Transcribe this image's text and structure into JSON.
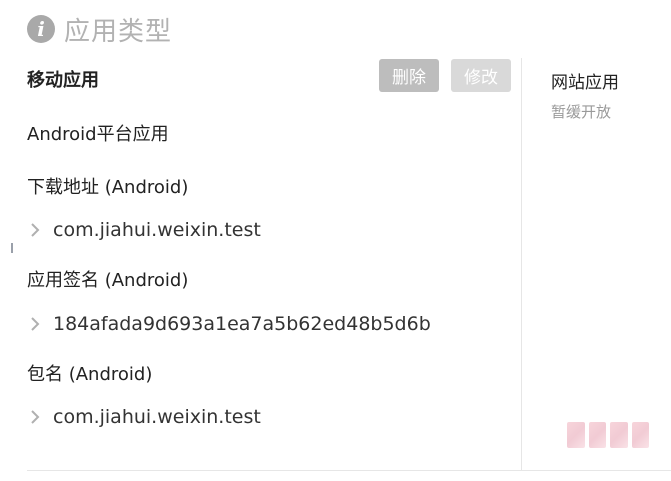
{
  "section": {
    "icon": "info-icon",
    "icon_glyph": "i",
    "title": "应用类型"
  },
  "mobile_app": {
    "title": "移动应用",
    "delete_label": "删除",
    "edit_label": "修改",
    "platform_label": "Android平台应用",
    "download_url_label": "下载地址 (Android)",
    "download_url_value": "com.jiahui.weixin.test",
    "signature_label": "应用签名 (Android)",
    "signature_value": "184afada9d693a1ea7a5b62ed48b5d6b",
    "package_label": "包名 (Android)",
    "package_value": "com.jiahui.weixin.test"
  },
  "website_app": {
    "title": "网站应用",
    "status": "暂缓开放"
  },
  "colors": {
    "icon_bg": "#a9a9a9",
    "title_gray": "#b2b2b2",
    "delete_btn": "#bdbdbd",
    "edit_btn": "#d9d9d9",
    "divider": "#e6e6e6"
  }
}
